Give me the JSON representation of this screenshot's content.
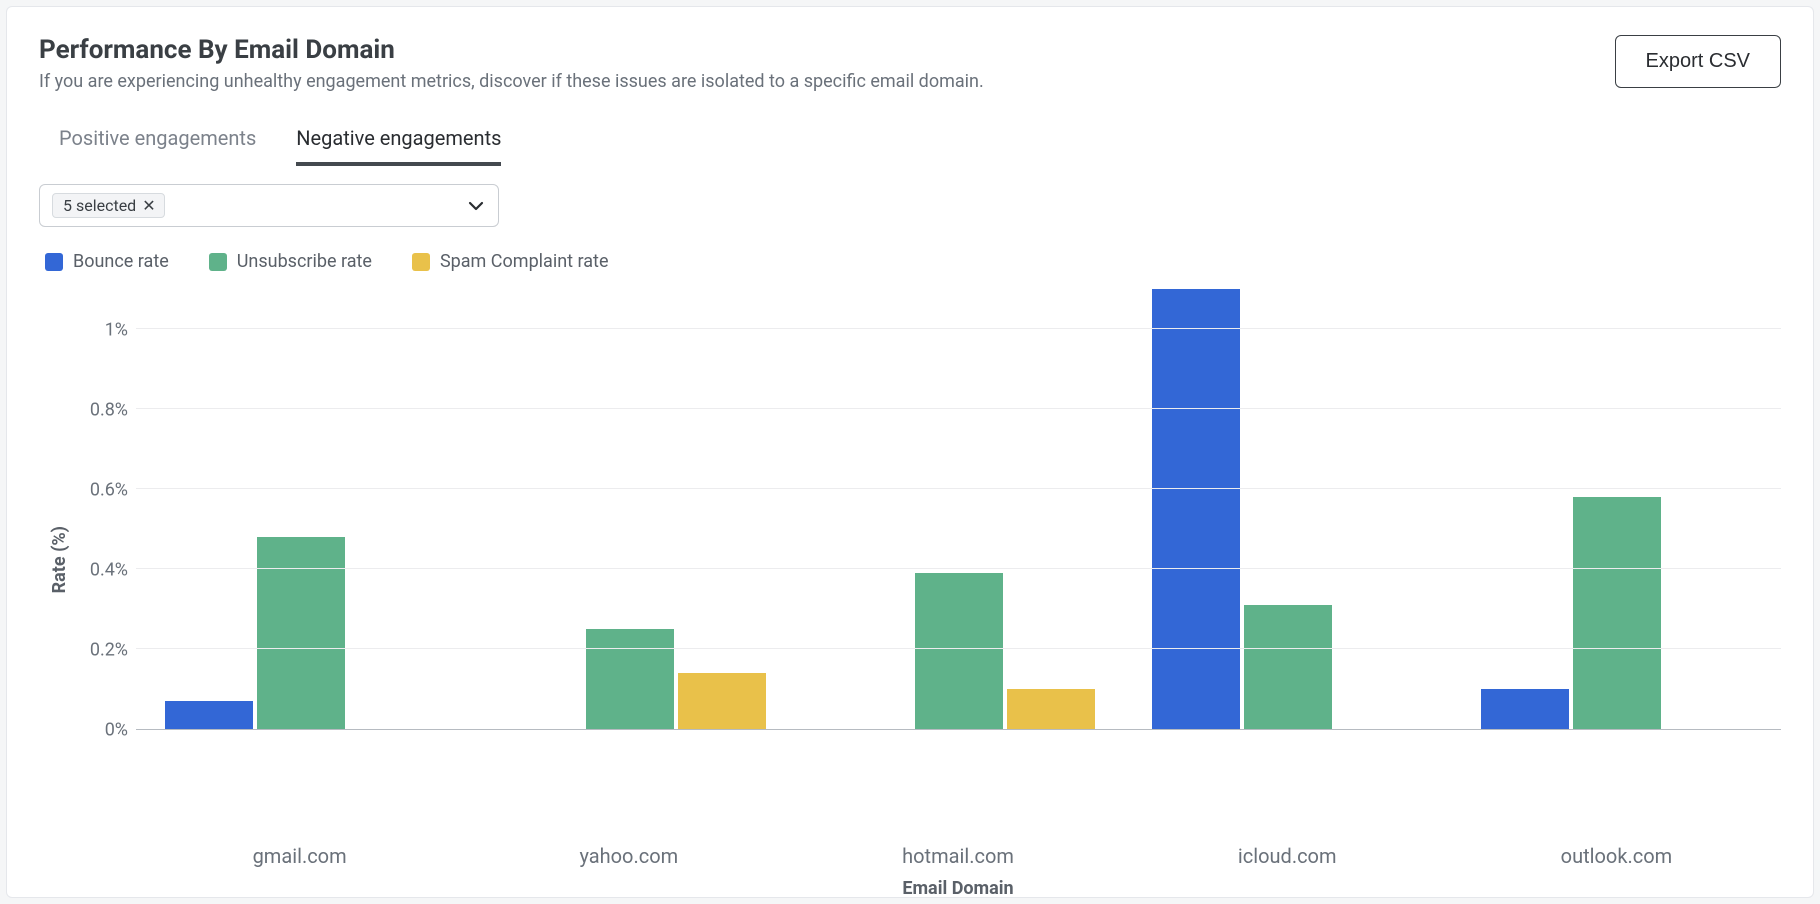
{
  "header": {
    "title": "Performance By Email Domain",
    "subtitle": "If you are experiencing unhealthy engagement metrics, discover if these issues are isolated to a specific email domain.",
    "export_label": "Export CSV"
  },
  "tabs": {
    "positive": "Positive engagements",
    "negative": "Negative engagements",
    "active": "negative"
  },
  "selector": {
    "chip_label": "5 selected"
  },
  "legend": {
    "bounce": "Bounce rate",
    "unsub": "Unsubscribe rate",
    "spam": "Spam Complaint rate"
  },
  "colors": {
    "bounce": "#3367d6",
    "unsub": "#5fb28a",
    "spam": "#e9c14a"
  },
  "chart_data": {
    "type": "bar",
    "title": "Performance By Email Domain",
    "xlabel": "Email Domain",
    "ylabel": "Rate (%)",
    "ylim": [
      0,
      1.1
    ],
    "yticks": [
      0,
      0.2,
      0.4,
      0.6,
      0.8,
      1.0
    ],
    "ytick_labels": [
      "0%",
      "0.2%",
      "0.4%",
      "0.6%",
      "0.8%",
      "1%"
    ],
    "categories": [
      "gmail.com",
      "yahoo.com",
      "hotmail.com",
      "icloud.com",
      "outlook.com"
    ],
    "series": [
      {
        "name": "Bounce rate",
        "color": "#3367d6",
        "values": [
          0.07,
          0.0,
          0.0,
          1.1,
          0.1
        ]
      },
      {
        "name": "Unsubscribe rate",
        "color": "#5fb28a",
        "values": [
          0.48,
          0.25,
          0.39,
          0.31,
          0.58
        ]
      },
      {
        "name": "Spam Complaint rate",
        "color": "#e9c14a",
        "values": [
          0.0,
          0.14,
          0.1,
          0.0,
          0.0
        ]
      }
    ]
  }
}
